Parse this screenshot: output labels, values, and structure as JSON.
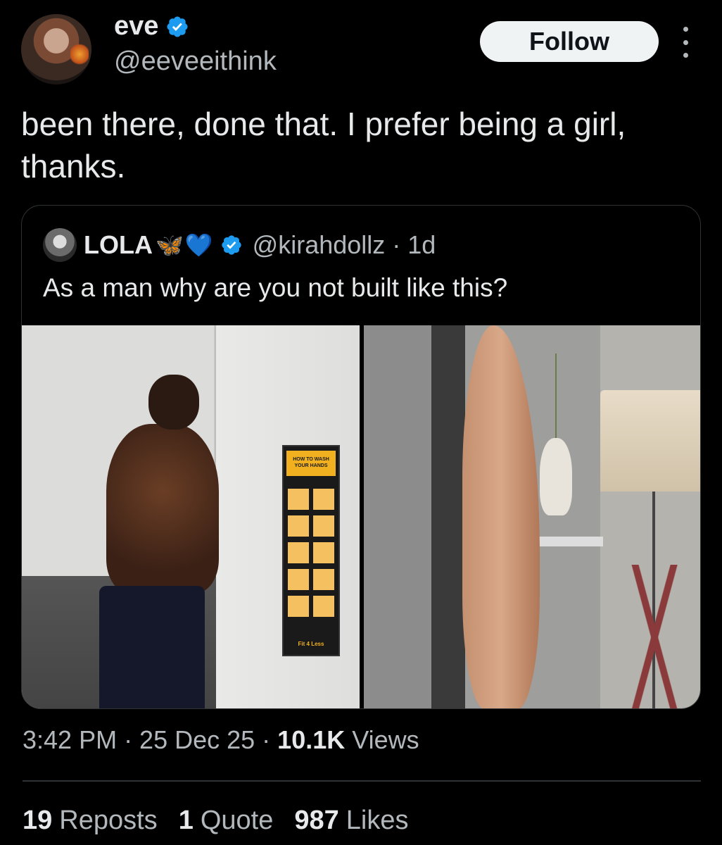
{
  "author": {
    "display_name": "eve",
    "handle": "@eeveeithink",
    "verified": true
  },
  "follow_label": "Follow",
  "tweet_text": "been there, done that. I prefer being a girl, thanks.",
  "quoted_tweet": {
    "display_name": "LOLA",
    "emoji_butterfly": "🦋",
    "emoji_heart": "💙",
    "handle_time": "@kirahdollz · 1d",
    "text": "As a man why are you not built like this?",
    "poster_title": "HOW TO WASH YOUR HANDS",
    "poster_footer": "Fit 4 Less"
  },
  "meta": {
    "time_date": "3:42 PM · 25 Dec 25 · ",
    "views_count": "10.1K",
    "views_label": " Views"
  },
  "stats": [
    {
      "count": "19",
      "label": "Reposts"
    },
    {
      "count": "1",
      "label": "Quote"
    },
    {
      "count": "987",
      "label": "Likes"
    }
  ],
  "colors": {
    "verified": "#1d9bf0",
    "background": "#000000",
    "text": "#e7e9ea",
    "secondary_text": "#b3b8bd"
  }
}
